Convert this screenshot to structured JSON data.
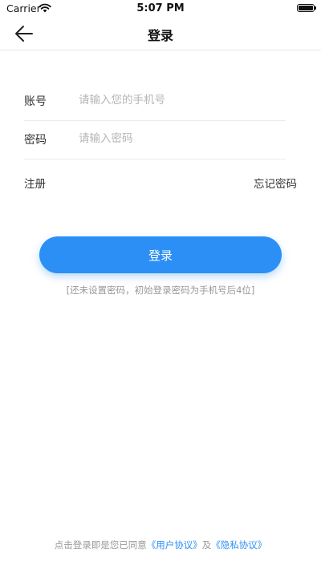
{
  "status_bar": {
    "carrier": "Carrier",
    "time": "5:07 PM"
  },
  "navbar": {
    "title": "登录",
    "back_icon": "arrow-left-icon"
  },
  "form": {
    "account": {
      "label": "账号",
      "placeholder": "请输入您的手机号",
      "value": ""
    },
    "password": {
      "label": "密码",
      "placeholder": "请输入密码",
      "value": ""
    }
  },
  "links": {
    "register": "注册",
    "forgot_password": "忘记密码"
  },
  "login_button": {
    "label": "登录"
  },
  "hint": "[还未设置密码，初始登录密码为手机号后4位]",
  "agreement": {
    "prefix": "点击登录即是您已同意",
    "user_agreement": "《用户协议》",
    "joiner": "及",
    "privacy_policy": "《隐私协议》"
  },
  "colors": {
    "accent": "#2b8ff5",
    "hint_text": "#999999",
    "divider": "#ececec"
  }
}
